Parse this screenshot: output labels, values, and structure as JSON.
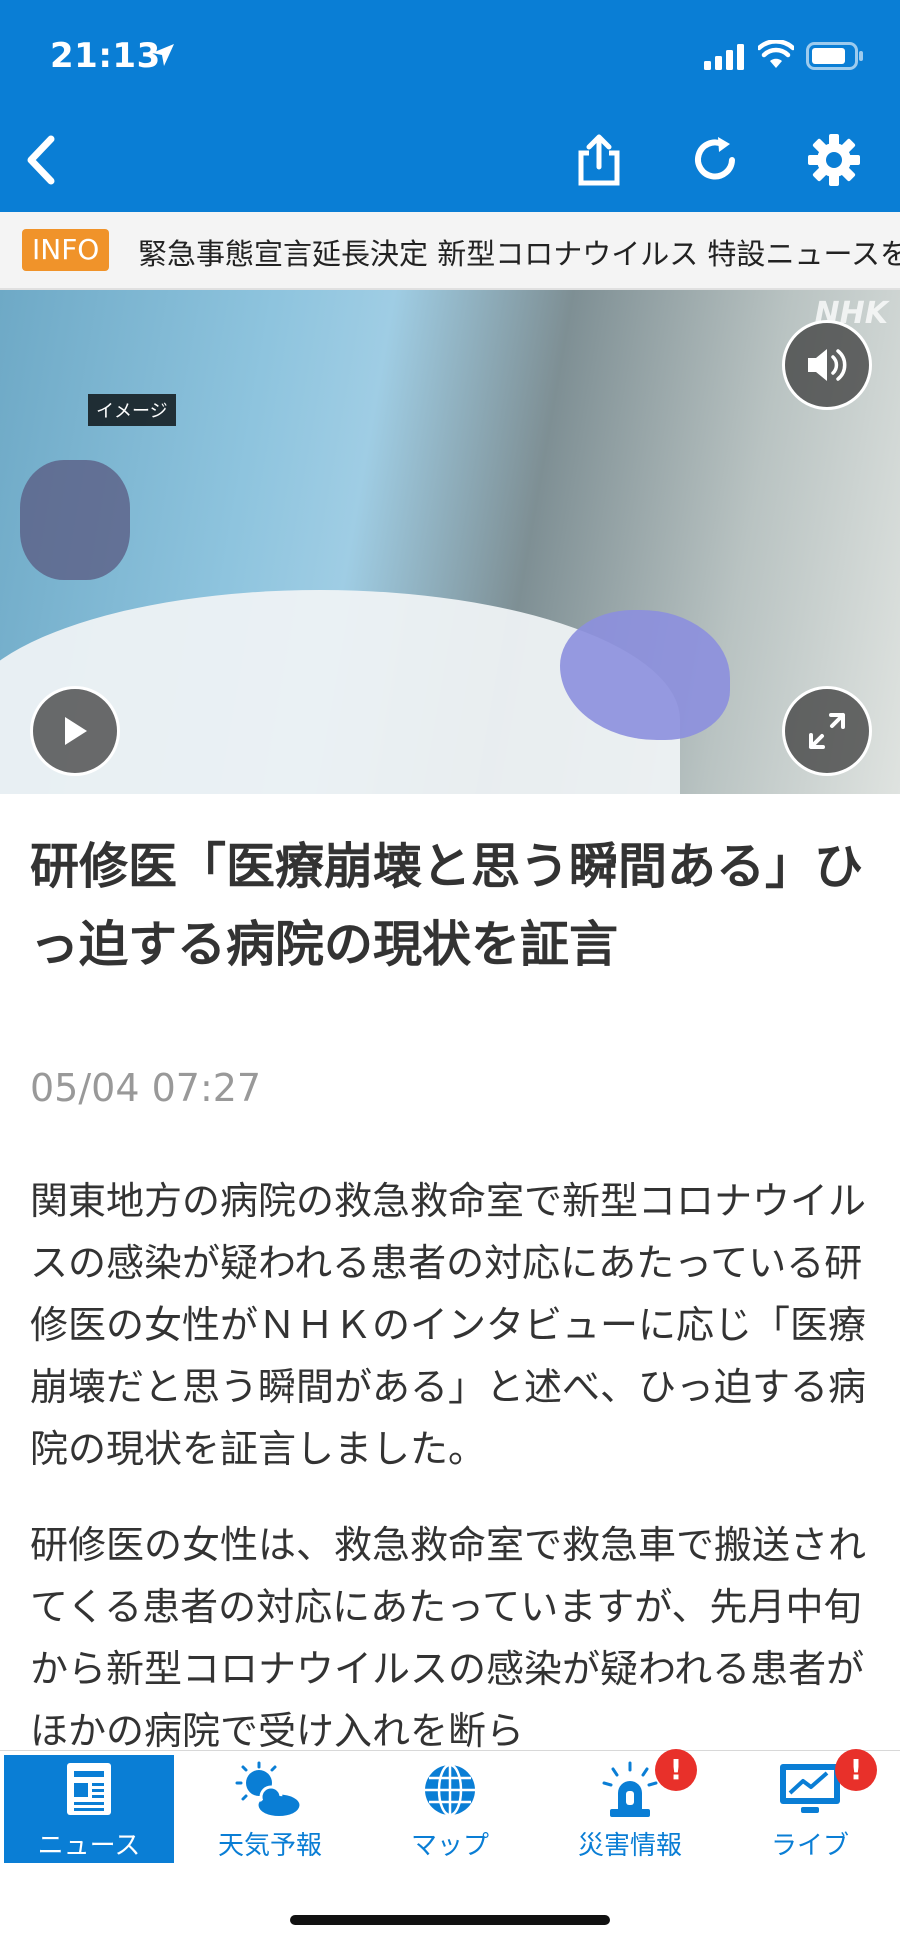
{
  "status_bar": {
    "time": "21:13"
  },
  "ticker": {
    "badge": "INFO",
    "text": "緊急事態宣言延長決定 新型コロナウイルス 特設ニュースを"
  },
  "video": {
    "watermark": "NHK",
    "caption_tag": "イメージ"
  },
  "article": {
    "headline": "研修医「医療崩壊と思う瞬間ある」ひっ迫する病院の現状を証言",
    "timestamp": "05/04 07:27",
    "paragraphs": [
      "関東地方の病院の救急救命室で新型コロナウイルスの感染が疑われる患者の対応にあたっている研修医の女性がＮＨＫのインタビューに応じ「医療崩壊だと思う瞬間がある」と述べ、ひっ迫する病院の現状を証言しました。",
      "研修医の女性は、救急救命室で救急車で搬送されてくる患者の対応にあたっていますが、先月中旬から新型コロナウイルスの感染が疑われる患者がほかの病院で受け入れを断ら"
    ]
  },
  "tabs": [
    {
      "label": "ニュース",
      "icon": "newspaper-icon",
      "active": true
    },
    {
      "label": "天気予報",
      "icon": "weather-icon"
    },
    {
      "label": "マップ",
      "icon": "globe-icon"
    },
    {
      "label": "災害情報",
      "icon": "alarm-light-icon",
      "badge": "!"
    },
    {
      "label": "ライブ",
      "icon": "live-tv-icon",
      "badge": "!"
    }
  ],
  "colors": {
    "brand_blue": "#0a7ed5",
    "info_orange": "#f0932a",
    "badge_red": "#e8302a"
  }
}
